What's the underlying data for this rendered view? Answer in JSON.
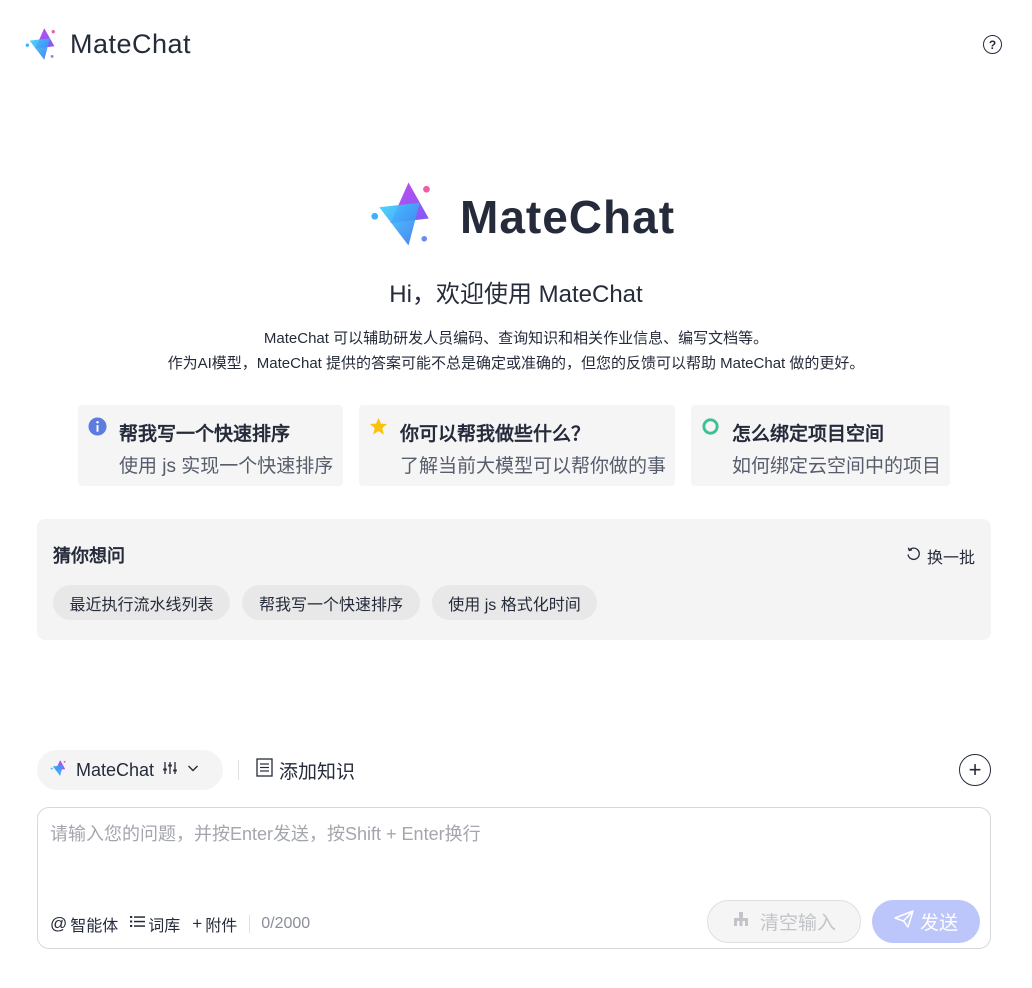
{
  "header": {
    "app_name": "MateChat",
    "help_icon": "question-circle-icon",
    "help_label": "?"
  },
  "hero": {
    "title": "MateChat",
    "greeting": "Hi，欢迎使用 MateChat",
    "description_line1": "MateChat 可以辅助研发人员编码、查询知识和相关作业信息、编写文档等。",
    "description_line2": "作为AI模型，MateChat 提供的答案可能不总是确定或准确的，但您的反馈可以帮助 MateChat 做的更好。"
  },
  "cards": [
    {
      "icon": "info-icon",
      "title": "帮我写一个快速排序",
      "subtitle": "使用 js 实现一个快速排序",
      "color": "#5e7ce0"
    },
    {
      "icon": "star-icon",
      "title": "你可以帮我做些什么？",
      "subtitle": "了解当前大模型可以帮你做的事",
      "color": "#fac20a"
    },
    {
      "icon": "ring-icon",
      "title": "怎么绑定项目空间",
      "subtitle": "如何绑定云空间中的项目",
      "color": "#3ac295"
    }
  ],
  "guess": {
    "title": "猜你想问",
    "refresh_label": "换一批",
    "chips": [
      "最近执行流水线列表",
      "帮我写一个快速排序",
      "使用 js 格式化时间"
    ]
  },
  "toolbar": {
    "model_name": "MateChat",
    "add_knowledge_label": "添加知识",
    "new_chat_label": "+"
  },
  "input": {
    "placeholder": "请输入您的问题，并按Enter发送，按Shift + Enter换行",
    "value": "",
    "agent_label": "智能体",
    "agent_symbol": "@",
    "lexicon_label": "词库",
    "attach_label": "附件",
    "attach_symbol": "+",
    "count": "0/2000",
    "clear_label": "清空输入",
    "send_label": "发送"
  },
  "colors": {
    "send_disabled": "#bcc6fb",
    "text_primary": "#252b3a"
  }
}
